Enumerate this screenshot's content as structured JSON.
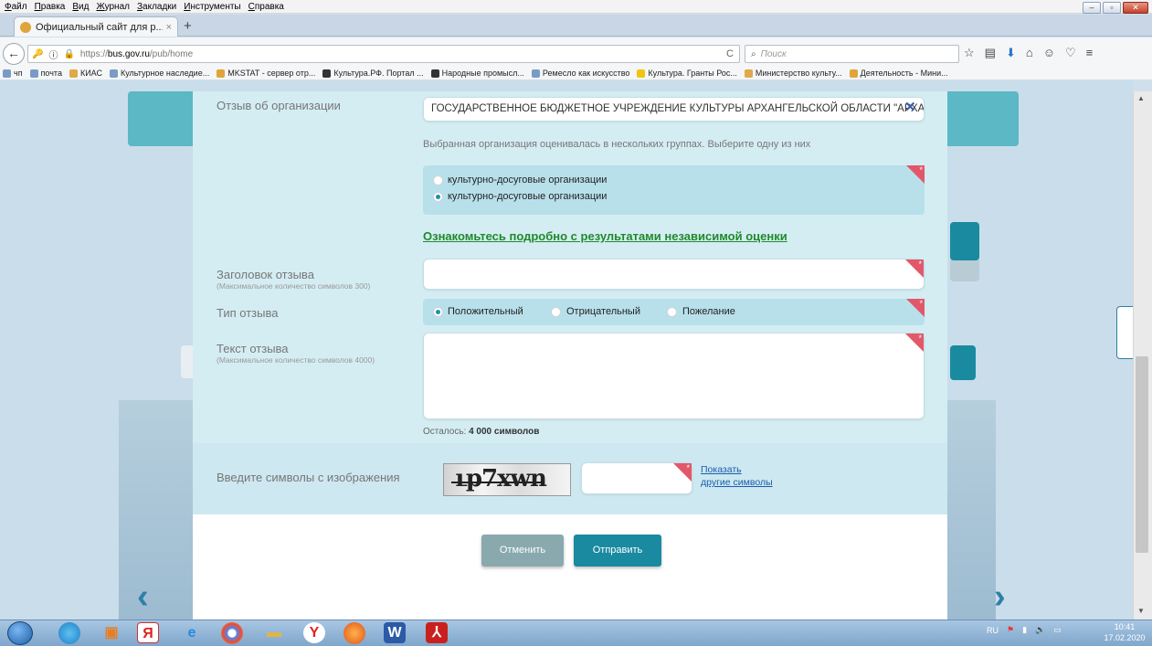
{
  "browser": {
    "menu": [
      "Файл",
      "Правка",
      "Вид",
      "Журнал",
      "Закладки",
      "Инструменты",
      "Справка"
    ],
    "tab_title": "Официальный сайт для р...",
    "url_prefix": "https://",
    "url_host": "bus.gov.ru",
    "url_path": "/pub/home",
    "search_placeholder": "Поиск",
    "bookmarks": [
      "чп",
      "почта",
      "КИАС",
      "Культурное наследие...",
      "MKSTAT - сервер отр...",
      "Культура.РФ. Портал ...",
      "Народные промысл...",
      "Ремесло как искусство",
      "Культура. Гранты Рос...",
      "Министерство культу...",
      "Деятельность - Мини..."
    ]
  },
  "form": {
    "org_label": "Отзыв об организации",
    "org_value": "ГОСУДАРСТВЕННОЕ БЮДЖЕТНОЕ УЧРЕЖДЕНИЕ КУЛЬТУРЫ АРХАНГЕЛЬСКОЙ ОБЛАСТИ \"АРХАНГЕЛЬСКИЙ",
    "group_hint": "Выбранная организация оценивалась в нескольких группах. Выберите одну из них",
    "groups": [
      "культурно-досуговые организации",
      "культурно-досуговые организации"
    ],
    "group_selected": 1,
    "results_link": "Ознакомьтесь подробно с результатами независимой оценки",
    "title_label": "Заголовок отзыва",
    "title_hint": "(Максимальное количество символов 300)",
    "type_label": "Тип отзыва",
    "types": [
      "Положительный",
      "Отрицательный",
      "Пожелание"
    ],
    "type_selected": 0,
    "text_label": "Текст отзыва",
    "text_hint": "(Максимальное количество символов 4000)",
    "remaining_prefix": "Осталось:",
    "remaining_value": "4 000 символов",
    "captcha_label": "Введите символы с изображения",
    "captcha_text": "ւp7xwn",
    "show_other_1": "Показать",
    "show_other_2": "другие символы",
    "cancel": "Отменить",
    "submit": "Отправить"
  },
  "taskbar": {
    "lang": "RU",
    "time": "10:41",
    "date": "17.02.2020"
  },
  "colors": {
    "accent": "#1a8aa0",
    "link_green": "#1f8a2a",
    "required_corner": "#e2586a",
    "modal_band": "#d4edf3"
  }
}
